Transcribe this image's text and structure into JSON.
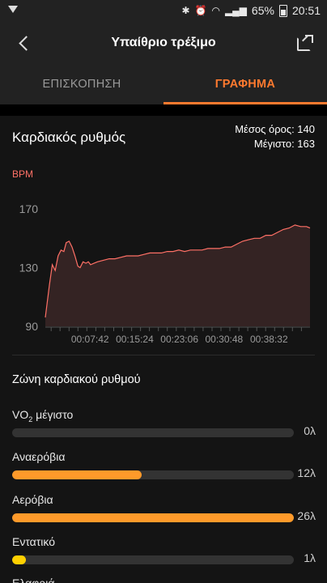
{
  "status_bar": {
    "battery": "65%",
    "time": "20:51"
  },
  "header": {
    "title": "Υπαίθριο τρέξιμο"
  },
  "tabs": [
    {
      "label": "ΕΠΙΣΚΟΠΗΣΗ",
      "active": false
    },
    {
      "label": "ΓΡΑΦΗΜΑ",
      "active": true
    }
  ],
  "heart_rate": {
    "title": "Καρδιακός ρυθμός",
    "avg": "Μέσος όρος: 140",
    "max": "Μέγιστο: 163"
  },
  "chart_data": {
    "type": "line",
    "ylabel": "BPM",
    "ylim": [
      90,
      170
    ],
    "yticks": [
      "170",
      "130",
      "90"
    ],
    "xticks": [
      "00:07:42",
      "00:15:24",
      "00:23:06",
      "00:30:48",
      "00:38:32"
    ],
    "x_minutes": [
      0,
      0.7,
      1.2,
      1.7,
      2.2,
      2.7,
      3.2,
      3.6,
      4.1,
      4.6,
      5.1,
      5.6,
      6.0,
      6.5,
      7.0,
      7.4,
      7.8,
      8.4,
      9,
      10,
      11,
      12,
      13,
      14,
      15,
      16,
      17,
      18,
      19,
      20,
      21,
      22,
      23,
      24,
      25,
      26,
      27,
      28,
      29,
      30,
      31,
      32,
      33,
      34,
      35,
      36,
      37,
      38,
      39,
      40,
      41,
      42,
      43,
      44,
      45,
      45.6
    ],
    "values": [
      96,
      118,
      132,
      128,
      138,
      142,
      141,
      147,
      148,
      144,
      138,
      131,
      130,
      134,
      133,
      134,
      132,
      133,
      134,
      135,
      136,
      136,
      137,
      138,
      138,
      138,
      139,
      140,
      140,
      140,
      141,
      141,
      142,
      141,
      142,
      142,
      142,
      143,
      143,
      143,
      144,
      144,
      146,
      148,
      149,
      150,
      150,
      152,
      152,
      154,
      156,
      157,
      159,
      158,
      158,
      157
    ],
    "colors": {
      "line": "#ff7066",
      "fill": "#3a2626",
      "grid": "#333333"
    }
  },
  "zones": {
    "title": "Ζώνη καρδιακού ρυθμού",
    "items": [
      {
        "label": "VO",
        "label_sub": "2",
        "label_rest": " μέγιστο",
        "count": "0λ",
        "fraction": 0.0,
        "color": "#ff9a2a"
      },
      {
        "label": "Αναερόβια",
        "count": "12λ",
        "fraction": 0.46,
        "color": "#ff9a2a"
      },
      {
        "label": "Αερόβια",
        "count": "26λ",
        "fraction": 1.0,
        "color": "#ff9a2a"
      },
      {
        "label": "Εντατικό",
        "count": "1λ",
        "fraction": 0.05,
        "color": "#ffd000"
      }
    ],
    "next_partial": "Ελαφριά"
  }
}
